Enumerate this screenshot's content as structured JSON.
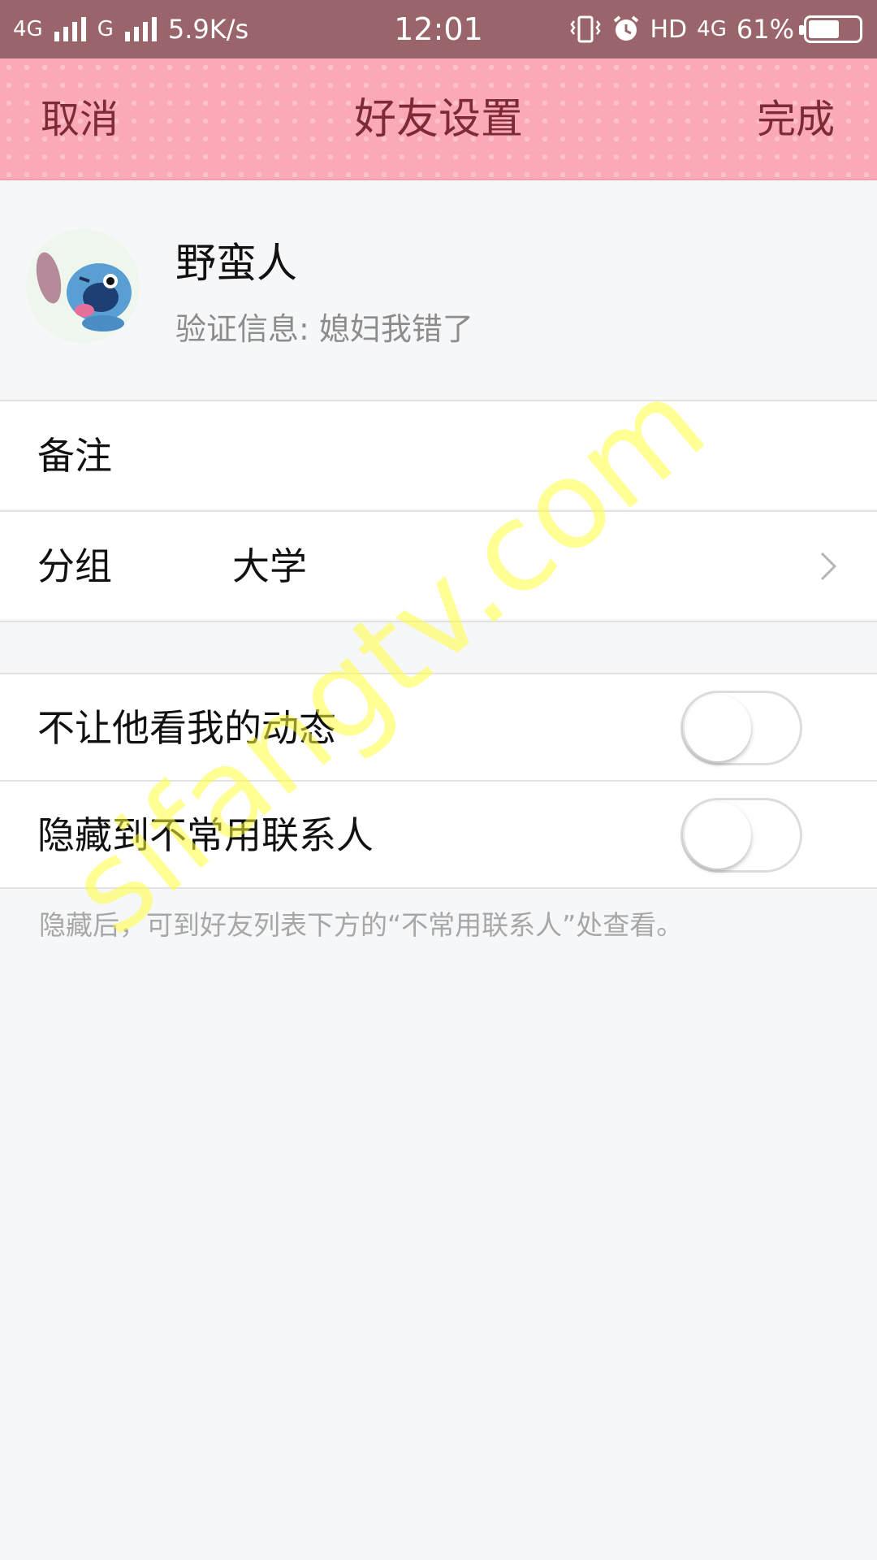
{
  "status_bar": {
    "network1": "4G",
    "network2": "G",
    "speed": "5.9K/s",
    "time": "12:01",
    "hd": "HD",
    "network3": "4G",
    "battery_percent": "61%",
    "battery_level": 0.61
  },
  "nav": {
    "cancel": "取消",
    "title": "好友设置",
    "done": "完成",
    "background_color": "#fba9b6",
    "text_color": "#7c2a36"
  },
  "profile": {
    "name": "野蛮人",
    "verify_label": "验证信息:",
    "verify_message": "媳妇我错了"
  },
  "rows": {
    "remark_label": "备注",
    "group_label": "分组",
    "group_value": "大学"
  },
  "toggles": [
    {
      "label": "不让他看我的动态",
      "on": false
    },
    {
      "label": "隐藏到不常用联系人",
      "on": false
    }
  ],
  "hint": "隐藏后，可到好友列表下方的“不常用联系人”处查看。",
  "watermark": "sifangtv.com"
}
